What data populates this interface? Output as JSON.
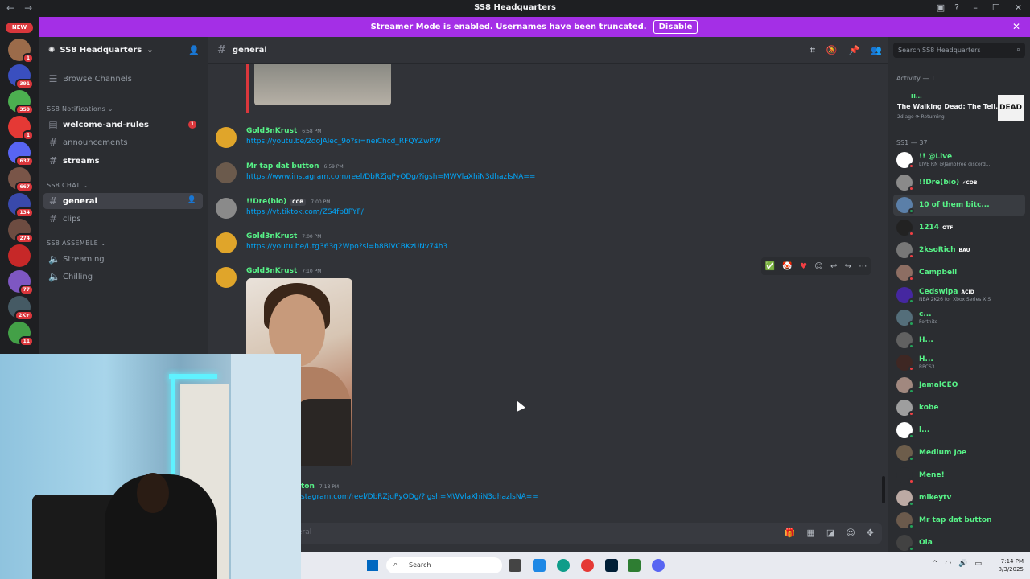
{
  "window": {
    "title": "SS8 Headquarters",
    "back": "←",
    "forward": "→",
    "controls": [
      "–",
      "☐",
      "✕"
    ],
    "tool_icons": [
      "inbox-icon",
      "help-icon"
    ]
  },
  "banner": {
    "text": "Streamer Mode is enabled. Usernames have been truncated.",
    "button": "Disable",
    "close": "✕"
  },
  "rail": {
    "new_tag": "NEW",
    "servers": [
      {
        "badge": "1",
        "color": "#9b6b4a"
      },
      {
        "badge": "391",
        "color": "#3a4fbf"
      },
      {
        "badge": "359",
        "color": "#4caf50"
      },
      {
        "badge": "1",
        "color": "#e53935"
      },
      {
        "badge": "637",
        "color": "#5865f2"
      },
      {
        "badge": "667",
        "color": "#795548"
      },
      {
        "badge": "134",
        "color": "#3949ab"
      },
      {
        "badge": "274",
        "color": "#6d4c41"
      },
      {
        "badge": "",
        "color": "#c62828"
      },
      {
        "badge": "77",
        "color": "#7e57c2"
      },
      {
        "badge": "2K+",
        "color": "#455a64"
      },
      {
        "badge": "11",
        "color": "#43a047"
      }
    ]
  },
  "sidebar": {
    "server_name": "SS8 Headquarters",
    "browse": "Browse Channels",
    "categories": [
      {
        "name": "SS8 Notifications",
        "channels": [
          {
            "name": "welcome-and-rules",
            "state": "bold",
            "badge": "1",
            "icon": "rules-icon"
          },
          {
            "name": "announcements",
            "state": "muted",
            "icon": "hash-icon"
          },
          {
            "name": "streams",
            "state": "bold",
            "icon": "hash-icon"
          }
        ]
      },
      {
        "name": "SS8 CHAT",
        "channels": [
          {
            "name": "general",
            "state": "active",
            "icon": "hash-icon"
          },
          {
            "name": "clips",
            "state": "muted",
            "icon": "hash-icon"
          }
        ]
      },
      {
        "name": "SS8 ASSEMBLE",
        "channels": [
          {
            "name": "Streaming",
            "state": "muted",
            "icon": "speaker-icon"
          },
          {
            "name": "Chilling",
            "state": "muted",
            "icon": "speaker-icon"
          }
        ]
      }
    ]
  },
  "chat": {
    "channel": "general",
    "messages": [
      {
        "author": "Gold3nKrust",
        "time": "6:58 PM",
        "tag": "",
        "link": "https://youtu.be/2doJAlec_9o?si=neiChcd_RFQYZwPW",
        "color": "#e0a52a"
      },
      {
        "author": "Mr tap dat button",
        "time": "6:59 PM",
        "tag": "",
        "link": "https://www.instagram.com/reel/DbRZjqPyQDg/?igsh=MWVlaXhiN3dhazlsNA==",
        "color": "#6b5a4c"
      },
      {
        "author": "!!Dre(bio)",
        "time": "7:00 PM",
        "tag": "COB",
        "link": "https://vt.tiktok.com/ZS4fp8PYF/",
        "color": "#8a8a8a"
      },
      {
        "author": "Gold3nKrust",
        "time": "7:00 PM",
        "tag": "",
        "link": "https://youtu.be/Utg363q2Wpo?si=b8BiVCBKzUNv74h3",
        "color": "#e0a52a"
      },
      {
        "author": "Gold3nKrust",
        "time": "7:10 PM",
        "tag": "",
        "link": "",
        "color": "#e0a52a"
      },
      {
        "author": "ton",
        "time": "7:13 PM",
        "tag": "",
        "link": "stagram.com/reel/DbRZjqPyQDg/?igsh=MWVlaXhiN3dhazlsNA==",
        "color": "#6b5a4c"
      }
    ],
    "composer_placeholder": "eral"
  },
  "members": {
    "search_placeholder": "Search SS8 Headquarters",
    "activity_header": "Activity — 1",
    "activity": {
      "user": "H...",
      "title": "The Walking Dead: The Tell...",
      "meta": "2d ago  ⟳ Returning",
      "poster": "DEAD"
    },
    "group_header": "SS1 — 37",
    "list": [
      {
        "name": "!! @Live",
        "sub": "LIVE RN @JamoFree discord...",
        "tag": "",
        "status": "dnd",
        "color": "#ffffff"
      },
      {
        "name": "!!Dre(bio)",
        "sub": "",
        "tag": "⚡COB",
        "status": "dnd",
        "color": "#8a8a8a"
      },
      {
        "name": "10 of them bitc...",
        "sub": "",
        "tag": "",
        "status": "online",
        "color": "#5b7fa8"
      },
      {
        "name": "1214",
        "sub": "",
        "tag": "OTF",
        "status": "dnd",
        "color": "#222222"
      },
      {
        "name": "2ksoRich",
        "sub": "",
        "tag": "BAU",
        "status": "dnd",
        "color": "#777777"
      },
      {
        "name": "Campbell",
        "sub": "",
        "tag": "",
        "status": "dnd",
        "color": "#8d6e63"
      },
      {
        "name": "Cedswipa",
        "sub": "NBA 2K26 for Xbox Series X|S",
        "tag": "ACID",
        "status": "online",
        "color": "#4527a0"
      },
      {
        "name": "c...",
        "sub": "Fortnite",
        "tag": "",
        "status": "online",
        "color": "#546e7a"
      },
      {
        "name": "H...",
        "sub": "",
        "tag": "",
        "status": "online",
        "color": "#616161"
      },
      {
        "name": "H...",
        "sub": "RPCS3",
        "tag": "",
        "status": "dnd",
        "color": "#3e2723"
      },
      {
        "name": "JamalCEO",
        "sub": "",
        "tag": "",
        "status": "online",
        "color": "#a1887f"
      },
      {
        "name": "kobe",
        "sub": "",
        "tag": "",
        "status": "dnd",
        "color": "#9e9e9e"
      },
      {
        "name": "l...",
        "sub": "",
        "tag": "",
        "status": "online",
        "color": "#ffffff"
      },
      {
        "name": "Medium Joe",
        "sub": "",
        "tag": "",
        "status": "online",
        "color": "#6d5d4b"
      },
      {
        "name": "Mene!",
        "sub": "",
        "tag": "",
        "status": "dnd",
        "color": "#2b2d31"
      },
      {
        "name": "mikeytv",
        "sub": "",
        "tag": "",
        "status": "online",
        "color": "#bcaaa4"
      },
      {
        "name": "Mr tap dat button",
        "sub": "",
        "tag": "",
        "status": "online",
        "color": "#6b5a4c"
      },
      {
        "name": "Ola",
        "sub": "",
        "tag": "",
        "status": "online",
        "color": "#424242"
      }
    ]
  },
  "taskbar": {
    "search": "Search",
    "time": "7:14 PM",
    "date": "8/3/2025"
  }
}
